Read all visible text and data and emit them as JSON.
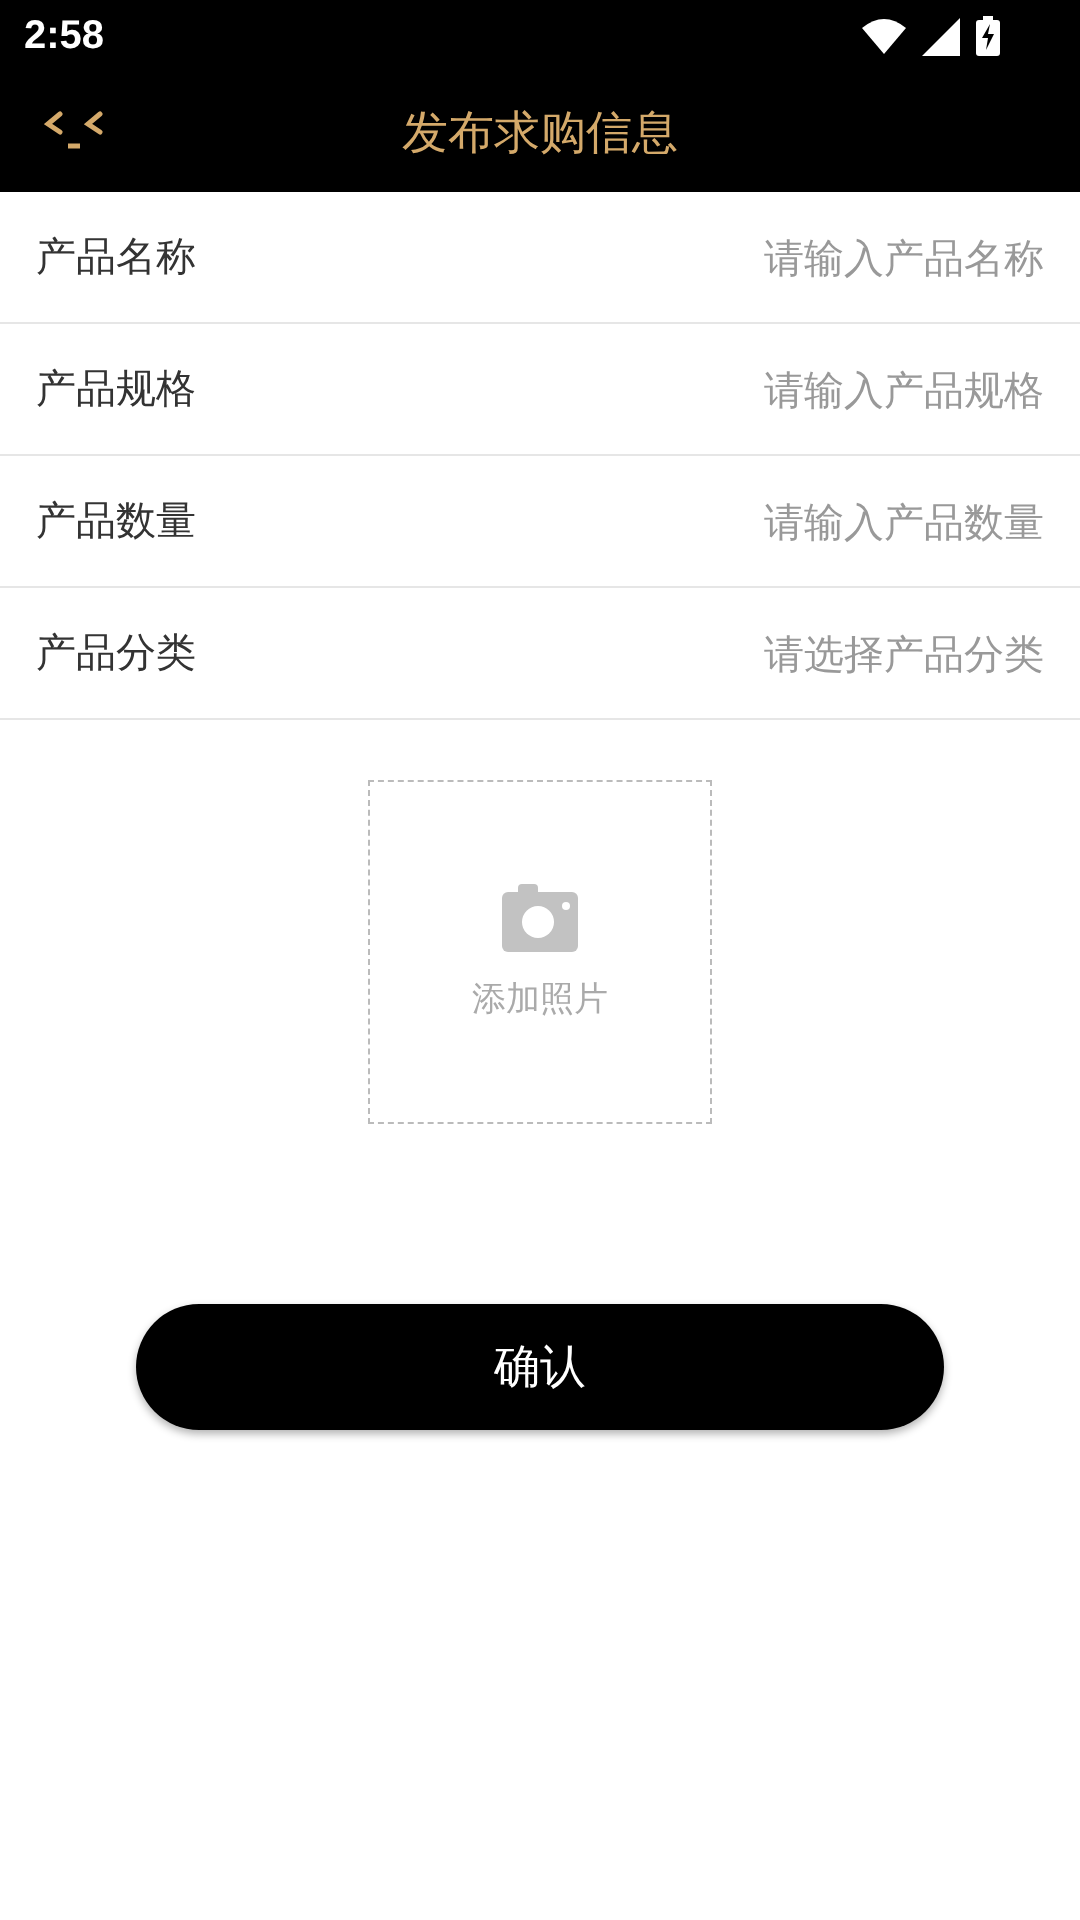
{
  "status_bar": {
    "time": "2:58"
  },
  "header": {
    "title": "发布求购信息"
  },
  "fields": [
    {
      "label": "产品名称",
      "placeholder": "请输入产品名称"
    },
    {
      "label": "产品规格",
      "placeholder": "请输入产品规格"
    },
    {
      "label": "产品数量",
      "placeholder": "请输入产品数量"
    },
    {
      "label": "产品分类",
      "placeholder": "请选择产品分类"
    }
  ],
  "photo_upload": {
    "label": "添加照片"
  },
  "confirm_button": "确认"
}
